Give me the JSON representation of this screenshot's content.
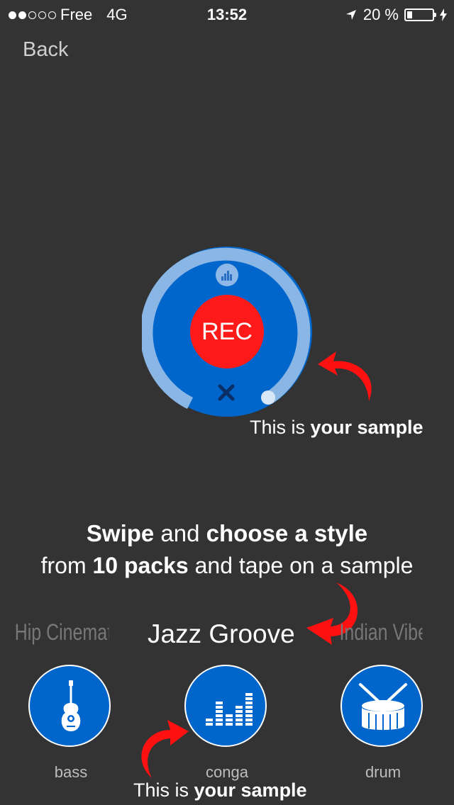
{
  "status_bar": {
    "carrier": "Free",
    "network": "4G",
    "time": "13:52",
    "battery": "20 %",
    "signal_dots_filled": 2,
    "signal_dots_total": 5
  },
  "nav": {
    "back_label": "Back"
  },
  "recorder": {
    "rec_label": "REC",
    "caption_prefix": "This is ",
    "caption_bold": "your sample"
  },
  "instructions": {
    "line1_bold1": "Swipe",
    "line1_mid": " and ",
    "line1_bold2": "choose a style",
    "line2_pre": "from ",
    "line2_bold": "10 packs",
    "line2_post": " and tape on a sample"
  },
  "packs": {
    "prev": "Hip Cinematic",
    "current": "Jazz Groove",
    "next": "Indian Vibe"
  },
  "instruments": [
    {
      "label": "bass",
      "icon": "guitar-icon"
    },
    {
      "label": "conga",
      "icon": "equalizer-icon"
    },
    {
      "label": "drum",
      "icon": "drum-icon"
    }
  ],
  "bottom_caption": {
    "prefix": "This is ",
    "bold": "your sample"
  },
  "colors": {
    "background": "#333333",
    "accent_blue": "#0066cc",
    "rec_red": "#ff1a1a",
    "arrow_red": "#ff1111"
  }
}
